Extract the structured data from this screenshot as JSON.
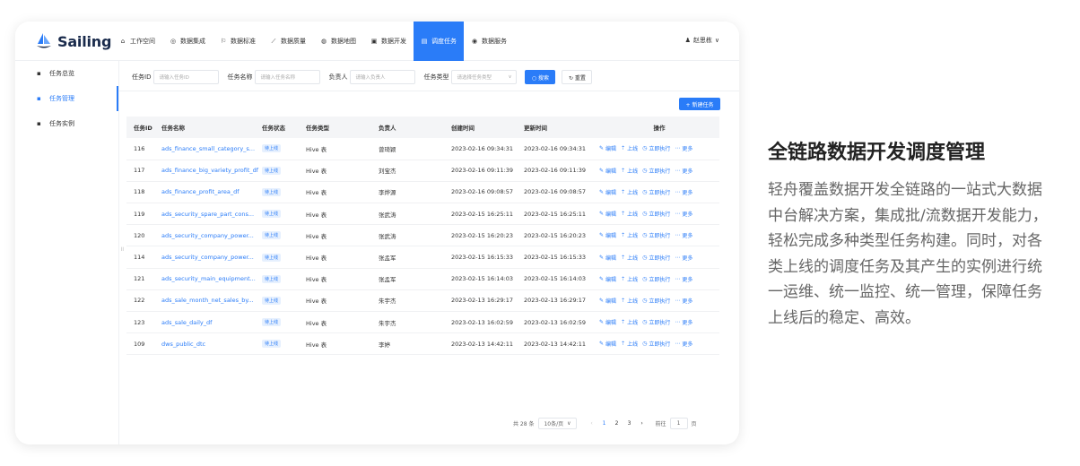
{
  "app": {
    "brand": "Sailing"
  },
  "nav": [
    {
      "label": "工作空间",
      "icon": "⌂"
    },
    {
      "label": "数据集成",
      "icon": "◎"
    },
    {
      "label": "数据标准",
      "icon": "⚐"
    },
    {
      "label": "数据质量",
      "icon": "⟋"
    },
    {
      "label": "数据地图",
      "icon": "◍"
    },
    {
      "label": "数据开发",
      "icon": "▣"
    },
    {
      "label": "调度任务",
      "icon": "▤"
    },
    {
      "label": "数据服务",
      "icon": "◉"
    }
  ],
  "user": {
    "name": "赵思栋",
    "icon": "♟",
    "caret": "∨"
  },
  "sidebar": [
    {
      "label": "任务总览",
      "icon": "▪"
    },
    {
      "label": "任务管理",
      "icon": "▪"
    },
    {
      "label": "任务实例",
      "icon": "▪"
    }
  ],
  "filters": {
    "task_id_label": "任务ID",
    "task_id_placeholder": "请输入任务ID",
    "task_name_label": "任务名称",
    "task_name_placeholder": "请输入任务名称",
    "owner_label": "负责人",
    "owner_placeholder": "请输入负责人",
    "task_type_label": "任务类型",
    "task_type_placeholder": "请选择任务类型",
    "search": "○ 搜索",
    "reset": "↻ 重置"
  },
  "new_task": "+ 新建任务",
  "table": {
    "headers": [
      "任务ID",
      "任务名称",
      "任务状态",
      "任务类型",
      "负责人",
      "创建时间",
      "更新时间",
      "操作"
    ],
    "rows": [
      [
        "116",
        "ads_finance_small_category_s...",
        "待上线",
        "Hive 表",
        "曾琦颖",
        "2023-02-16 09:34:31",
        "2023-02-16 09:34:31"
      ],
      [
        "117",
        "ads_finance_big_variety_profit_df",
        "待上线",
        "Hive 表",
        "刘宝杰",
        "2023-02-16 09:11:39",
        "2023-02-16 09:11:39"
      ],
      [
        "118",
        "ads_finance_profit_area_df",
        "待上线",
        "Hive 表",
        "李烨源",
        "2023-02-16 09:08:57",
        "2023-02-16 09:08:57"
      ],
      [
        "119",
        "ads_security_spare_part_cons...",
        "待上线",
        "Hive 表",
        "张武涛",
        "2023-02-15 16:25:11",
        "2023-02-15 16:25:11"
      ],
      [
        "120",
        "ads_security_company_power...",
        "待上线",
        "Hive 表",
        "张武涛",
        "2023-02-15 16:20:23",
        "2023-02-15 16:20:23"
      ],
      [
        "114",
        "ads_security_company_power...",
        "待上线",
        "Hive 表",
        "张孟军",
        "2023-02-15 16:15:33",
        "2023-02-15 16:15:33"
      ],
      [
        "121",
        "ads_security_main_equipment...",
        "待上线",
        "Hive 表",
        "张孟军",
        "2023-02-15 16:14:03",
        "2023-02-15 16:14:03"
      ],
      [
        "122",
        "ads_sale_month_net_sales_by...",
        "待上线",
        "Hive 表",
        "朱宇杰",
        "2023-02-13 16:29:17",
        "2023-02-13 16:29:17"
      ],
      [
        "123",
        "ads_sale_daily_df",
        "待上线",
        "Hive 表",
        "朱宇杰",
        "2023-02-13 16:02:59",
        "2023-02-13 16:02:59"
      ],
      [
        "109",
        "dws_public_dtc",
        "待上线",
        "Hive 表",
        "李婷",
        "2023-02-13 14:42:11",
        "2023-02-13 14:42:11"
      ]
    ],
    "ops": [
      {
        "label": "编辑",
        "icon": "✎"
      },
      {
        "label": "上线",
        "icon": "⇡"
      },
      {
        "label": "立即执行",
        "icon": "◷"
      },
      {
        "label": "更多",
        "icon": "⋯"
      }
    ]
  },
  "pager": {
    "total": "共 28 条",
    "page_size": "10条/页",
    "size_caret": "∨",
    "prev": "‹",
    "next": "›",
    "pages": [
      "1",
      "2",
      "3"
    ],
    "jump_label": "前往",
    "jump_value": "1",
    "jump_suffix": "页"
  },
  "side_text": {
    "heading": "全链路数据开发调度管理",
    "desc": "轻舟覆盖数据开发全链路的一站式大数据中台解决方案，集成批/流数据开发能力，轻松完成多种类型任务构建。同时，对各类上线的调度任务及其产生的实例进行统一运维、统一监控、统一管理，保障任务上线后的稳定、高效。"
  },
  "colors": {
    "accent": "#2a7cf8"
  }
}
